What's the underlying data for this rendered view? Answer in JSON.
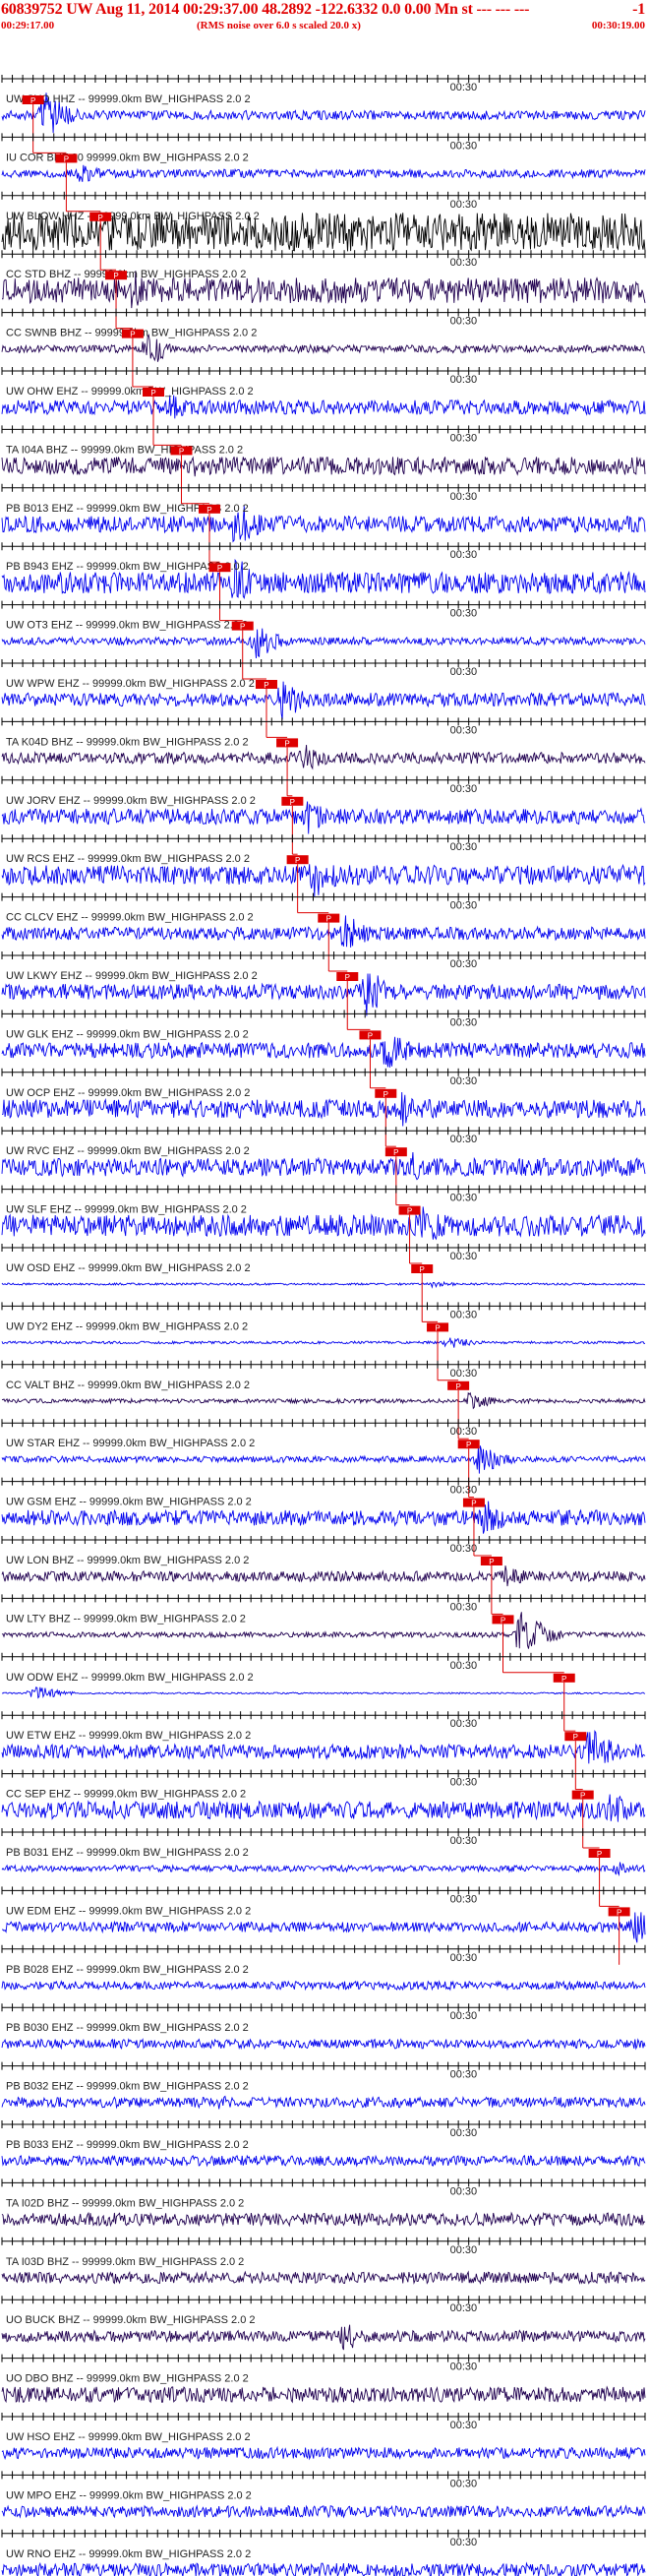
{
  "header": {
    "title": "60839752 UW Aug 11, 2014 00:29:37.00   48.2892 -122.6332  0.0 0.00 Mn st --- --- ---",
    "title_end": "-1",
    "start_time": "00:29:17.00",
    "rms_note": "(RMS noise over 6.0 s scaled 20.0 x)",
    "end_time": "00:30:19.00"
  },
  "colors": {
    "trace_blue": "#0000ee",
    "trace_dark": "#200050",
    "trace_black": "#000000",
    "marker_red": "#dd0000",
    "label_dark": "#222222",
    "grid": "#000000"
  },
  "chart_data": {
    "type": "line",
    "title": "60839752 UW Aug 11, 2014 00:29:37.00   48.2892 -122.6332  0.0 0.00 Mn st --- --- ---",
    "xlabel": "",
    "ylabel": "",
    "xlim": [
      0,
      62
    ],
    "x_tick_spacing_s": 1,
    "time_label": "00:30",
    "time_label_at_s": 43,
    "grid": false,
    "pick_label": "P",
    "traces": [
      {
        "label": "UW SYO HHZ -- 99999.0km BW_HIGHPASS  2.0  2",
        "pick_s": 3.0,
        "amp": 0.18,
        "event_s": 4.0,
        "event_amp": 0.95,
        "color": "trace_blue"
      },
      {
        "label": "IU COR BHZ 00 99999.0km BW_HIGHPASS  2.0  2",
        "pick_s": 6.2,
        "amp": 0.16,
        "event_s": 7.5,
        "event_amp": 0.4,
        "color": "trace_blue"
      },
      {
        "label": "UW BLOW HHZ -- 99999.0km BW_HIGHPASS  2.0  2",
        "pick_s": 9.5,
        "amp": 0.75,
        "event_s": 10.5,
        "event_amp": 0.9,
        "color": "trace_black"
      },
      {
        "label": "CC STD BHZ -- 99999.0km BW_HIGHPASS  2.0  2",
        "pick_s": 11.0,
        "amp": 0.5,
        "event_s": 12.5,
        "event_amp": 0.85,
        "color": "trace_dark"
      },
      {
        "label": "CC SWNB BHZ -- 99999.0km BW_HIGHPASS  2.0  2",
        "pick_s": 12.6,
        "amp": 0.15,
        "event_s": 14.0,
        "event_amp": 0.7,
        "color": "trace_dark"
      },
      {
        "label": "UW OHW EHZ -- 99999.0km BW_HIGHPASS  2.0  2",
        "pick_s": 14.6,
        "amp": 0.28,
        "event_s": 16.0,
        "event_amp": 0.55,
        "color": "trace_blue"
      },
      {
        "label": "TA I04A BHZ -- 99999.0km BW_HIGHPASS  2.0  2",
        "pick_s": 17.3,
        "amp": 0.35,
        "event_s": 18.5,
        "event_amp": 0.45,
        "color": "trace_dark"
      },
      {
        "label": "PB B013 EHZ -- 99999.0km BW_HIGHPASS  2.0  2",
        "pick_s": 20.0,
        "amp": 0.32,
        "event_s": 22.5,
        "event_amp": 1.0,
        "color": "trace_blue"
      },
      {
        "label": "PB B943 EHZ -- 99999.0km BW_HIGHPASS  2.0  2",
        "pick_s": 21.0,
        "amp": 0.42,
        "event_s": 22.5,
        "event_amp": 1.0,
        "color": "trace_blue"
      },
      {
        "label": "UW OT3 EHZ -- 99999.0km BW_HIGHPASS  2.0  2",
        "pick_s": 23.2,
        "amp": 0.15,
        "event_s": 24.5,
        "event_amp": 0.7,
        "color": "trace_blue"
      },
      {
        "label": "UW WPW EHZ -- 99999.0km BW_HIGHPASS  2.0  2",
        "pick_s": 25.5,
        "amp": 0.26,
        "event_s": 27.0,
        "event_amp": 0.85,
        "color": "trace_blue"
      },
      {
        "label": "TA K04D BHZ -- 99999.0km BW_HIGHPASS  2.0  2",
        "pick_s": 27.5,
        "amp": 0.22,
        "event_s": 29.0,
        "event_amp": 0.6,
        "color": "trace_dark"
      },
      {
        "label": "UW JORV EHZ -- 99999.0km BW_HIGHPASS  2.0  2",
        "pick_s": 28.0,
        "amp": 0.3,
        "event_s": 29.5,
        "event_amp": 0.7,
        "color": "trace_blue"
      },
      {
        "label": "UW RCS EHZ -- 99999.0km BW_HIGHPASS  2.0  2",
        "pick_s": 28.5,
        "amp": 0.38,
        "event_s": 30.0,
        "event_amp": 1.0,
        "color": "trace_blue"
      },
      {
        "label": "CC CLCV EHZ -- 99999.0km BW_HIGHPASS  2.0  2",
        "pick_s": 31.5,
        "amp": 0.25,
        "event_s": 33.0,
        "event_amp": 0.75,
        "color": "trace_blue"
      },
      {
        "label": "UW LKWY EHZ -- 99999.0km BW_HIGHPASS  2.0  2",
        "pick_s": 33.3,
        "amp": 0.3,
        "event_s": 35.0,
        "event_amp": 1.0,
        "color": "trace_blue"
      },
      {
        "label": "UW GLK EHZ -- 99999.0km BW_HIGHPASS  2.0  2",
        "pick_s": 35.5,
        "amp": 0.3,
        "event_s": 37.0,
        "event_amp": 0.85,
        "color": "trace_blue"
      },
      {
        "label": "UW OCP EHZ -- 99999.0km BW_HIGHPASS  2.0  2",
        "pick_s": 37.0,
        "amp": 0.36,
        "event_s": 38.5,
        "event_amp": 0.7,
        "color": "trace_blue"
      },
      {
        "label": "UW RVC EHZ -- 99999.0km BW_HIGHPASS  2.0  2",
        "pick_s": 38.0,
        "amp": 0.35,
        "event_s": 39.5,
        "event_amp": 0.6,
        "color": "trace_blue"
      },
      {
        "label": "UW SLF EHZ -- 99999.0km BW_HIGHPASS  2.0  2",
        "pick_s": 39.3,
        "amp": 0.42,
        "event_s": 40.5,
        "event_amp": 1.0,
        "color": "trace_blue"
      },
      {
        "label": "UW OSD EHZ -- 99999.0km BW_HIGHPASS  2.0  2",
        "pick_s": 40.5,
        "amp": 0.04,
        "event_s": 41.5,
        "event_amp": 0.15,
        "color": "trace_blue"
      },
      {
        "label": "UW DY2 EHZ -- 99999.0km BW_HIGHPASS  2.0  2",
        "pick_s": 42.0,
        "amp": 0.05,
        "event_s": 43.0,
        "event_amp": 0.25,
        "color": "trace_blue"
      },
      {
        "label": "CC VALT BHZ -- 99999.0km BW_HIGHPASS  2.0  2",
        "pick_s": 44.0,
        "amp": 0.08,
        "event_s": 45.0,
        "event_amp": 0.35,
        "color": "trace_dark"
      },
      {
        "label": "UW STAR EHZ -- 99999.0km BW_HIGHPASS  2.0  2",
        "pick_s": 45.0,
        "amp": 0.12,
        "event_s": 46.0,
        "event_amp": 0.6,
        "color": "trace_blue"
      },
      {
        "label": "UW GSM EHZ -- 99999.0km BW_HIGHPASS  2.0  2",
        "pick_s": 45.5,
        "amp": 0.3,
        "event_s": 46.5,
        "event_amp": 0.75,
        "color": "trace_blue"
      },
      {
        "label": "UW LON BHZ -- 99999.0km BW_HIGHPASS  2.0  2",
        "pick_s": 47.2,
        "amp": 0.2,
        "event_s": 48.5,
        "event_amp": 0.45,
        "color": "trace_dark"
      },
      {
        "label": "UW LTY BHZ -- 99999.0km BW_HIGHPASS  2.0  2",
        "pick_s": 48.3,
        "amp": 0.1,
        "event_s": 50.0,
        "event_amp": 1.0,
        "color": "trace_dark"
      },
      {
        "label": "UW ODW EHZ -- 99999.0km BW_HIGHPASS  2.0  2",
        "pick_s": 54.2,
        "amp": 0.03,
        "event_s": 3.0,
        "event_amp": 0.3,
        "color": "trace_blue"
      },
      {
        "label": "UW ETW EHZ -- 99999.0km BW_HIGHPASS  2.0  2",
        "pick_s": 55.3,
        "amp": 0.28,
        "event_s": 56.5,
        "event_amp": 1.0,
        "color": "trace_blue"
      },
      {
        "label": "CC SEP EHZ -- 99999.0km BW_HIGHPASS  2.0  2",
        "pick_s": 56.0,
        "amp": 0.34,
        "event_s": 58.5,
        "event_amp": 0.75,
        "color": "trace_blue"
      },
      {
        "label": "PB B031 EHZ -- 99999.0km BW_HIGHPASS  2.0  2",
        "pick_s": 57.6,
        "amp": 0.12,
        "event_s": 59.0,
        "event_amp": 0.3,
        "color": "trace_blue"
      },
      {
        "label": "UW EDM EHZ -- 99999.0km BW_HIGHPASS  2.0  2",
        "pick_s": 59.5,
        "amp": 0.2,
        "event_s": 61.0,
        "event_amp": 0.75,
        "color": "trace_blue"
      },
      {
        "label": "PB B028 EHZ -- 99999.0km BW_HIGHPASS  2.0  2",
        "pick_s": null,
        "amp": 0.16,
        "event_s": null,
        "event_amp": 0,
        "color": "trace_blue"
      },
      {
        "label": "PB B030 EHZ -- 99999.0km BW_HIGHPASS  2.0  2",
        "pick_s": null,
        "amp": 0.18,
        "event_s": null,
        "event_amp": 0,
        "color": "trace_blue"
      },
      {
        "label": "PB B032 EHZ -- 99999.0km BW_HIGHPASS  2.0  2",
        "pick_s": null,
        "amp": 0.2,
        "event_s": 21.0,
        "event_amp": 0.3,
        "color": "trace_blue"
      },
      {
        "label": "PB B033 EHZ -- 99999.0km BW_HIGHPASS  2.0  2",
        "pick_s": null,
        "amp": 0.2,
        "event_s": null,
        "event_amp": 0,
        "color": "trace_blue"
      },
      {
        "label": "TA I02D BHZ -- 99999.0km BW_HIGHPASS  2.0  2",
        "pick_s": null,
        "amp": 0.25,
        "event_s": null,
        "event_amp": 0,
        "color": "trace_dark"
      },
      {
        "label": "TA I03D BHZ -- 99999.0km BW_HIGHPASS  2.0  2",
        "pick_s": null,
        "amp": 0.22,
        "event_s": null,
        "event_amp": 0,
        "color": "trace_dark"
      },
      {
        "label": "UO BUCK BHZ -- 99999.0km BW_HIGHPASS  2.0  2",
        "pick_s": null,
        "amp": 0.22,
        "event_s": 33.0,
        "event_amp": 0.6,
        "color": "trace_dark"
      },
      {
        "label": "UO DBO BHZ -- 99999.0km BW_HIGHPASS  2.0  2",
        "pick_s": null,
        "amp": 0.3,
        "event_s": null,
        "event_amp": 0,
        "color": "trace_dark"
      },
      {
        "label": "UW HSO EHZ -- 99999.0km BW_HIGHPASS  2.0  2",
        "pick_s": null,
        "amp": 0.22,
        "event_s": null,
        "event_amp": 0,
        "color": "trace_blue"
      },
      {
        "label": "UW MPO EHZ -- 99999.0km BW_HIGHPASS  2.0  2",
        "pick_s": null,
        "amp": 0.22,
        "event_s": null,
        "event_amp": 0,
        "color": "trace_blue"
      },
      {
        "label": "UW RNO EHZ -- 99999.0km BW_HIGHPASS  2.0  2",
        "pick_s": null,
        "amp": 0.26,
        "event_s": null,
        "event_amp": 0,
        "color": "trace_blue"
      }
    ]
  }
}
